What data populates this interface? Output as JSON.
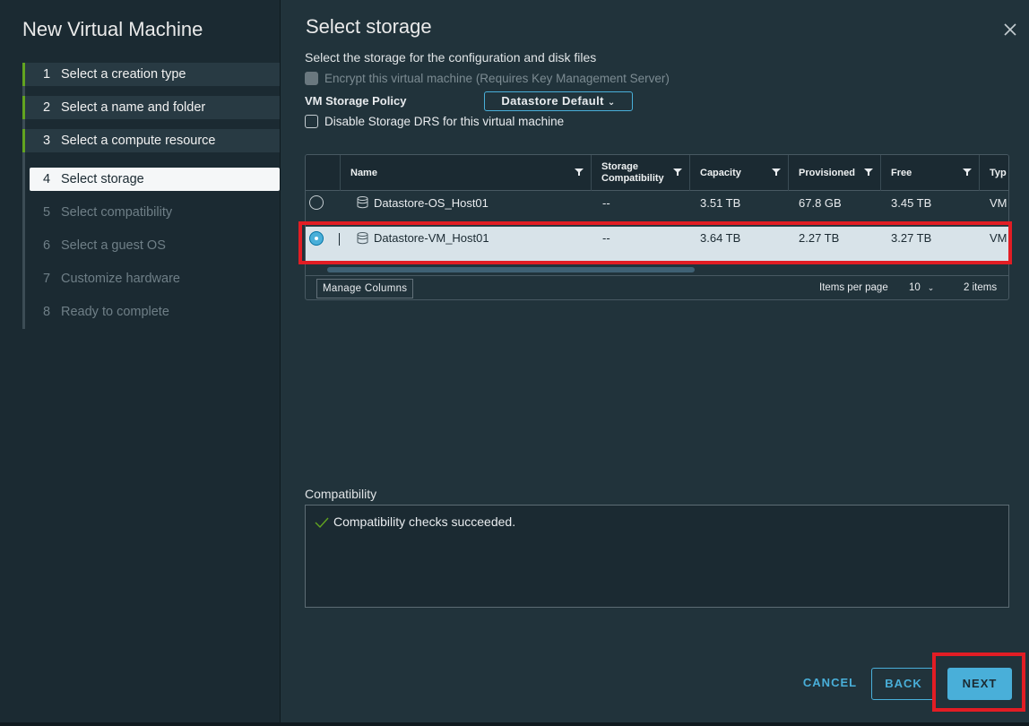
{
  "wizard": {
    "title": "New Virtual Machine",
    "steps": [
      {
        "num": "1",
        "label": "Select a creation type",
        "state": "done"
      },
      {
        "num": "2",
        "label": "Select a name and folder",
        "state": "done"
      },
      {
        "num": "3",
        "label": "Select a compute resource",
        "state": "done"
      },
      {
        "num": "4",
        "label": "Select storage",
        "state": "current"
      },
      {
        "num": "5",
        "label": "Select compatibility",
        "state": "todo"
      },
      {
        "num": "6",
        "label": "Select a guest OS",
        "state": "todo"
      },
      {
        "num": "7",
        "label": "Customize hardware",
        "state": "todo"
      },
      {
        "num": "8",
        "label": "Ready to complete",
        "state": "todo"
      }
    ]
  },
  "page": {
    "title": "Select storage",
    "subtitle": "Select the storage for the configuration and disk files",
    "encrypt_label": "Encrypt this virtual machine (Requires Key Management Server)",
    "policy_label": "VM Storage Policy",
    "policy_value": "Datastore Default",
    "disable_drs_label": "Disable Storage DRS for this virtual machine"
  },
  "grid": {
    "columns": [
      "Name",
      "Storage Compatibility",
      "Capacity",
      "Provisioned",
      "Free",
      "Typ"
    ],
    "rows": [
      {
        "name": "Datastore-OS_Host01",
        "compat": "--",
        "capacity": "3.51 TB",
        "provisioned": "67.8 GB",
        "free": "3.45 TB",
        "type": "VM",
        "selected": false
      },
      {
        "name": "Datastore-VM_Host01",
        "compat": "--",
        "capacity": "3.64 TB",
        "provisioned": "2.27 TB",
        "free": "3.27 TB",
        "type": "VM",
        "selected": true
      }
    ],
    "manage_columns": "Manage Columns",
    "items_per_page_label": "Items per page",
    "items_per_page_value": "10",
    "items_count": "2 items"
  },
  "compatibility": {
    "label": "Compatibility",
    "message": "Compatibility checks succeeded."
  },
  "buttons": {
    "cancel": "CANCEL",
    "back": "BACK",
    "next": "NEXT"
  },
  "colors": {
    "accent": "#49afd9",
    "done_bar": "#62a420",
    "highlight": "#e21d24"
  }
}
